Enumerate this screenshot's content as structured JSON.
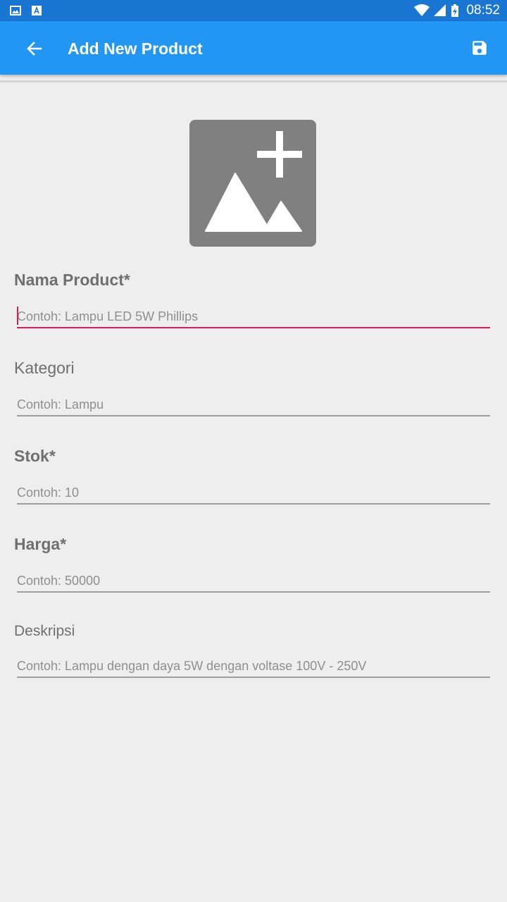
{
  "status_bar": {
    "time": "08:52"
  },
  "app_bar": {
    "title": "Add New Product"
  },
  "form": {
    "fields": [
      {
        "label": "Nama Product*",
        "placeholder": "Contoh: Lampu LED 5W Phillips",
        "value": ""
      },
      {
        "label": "Kategori",
        "placeholder": "Contoh: Lampu",
        "value": ""
      },
      {
        "label": "Stok*",
        "placeholder": "Contoh: 10",
        "value": ""
      },
      {
        "label": "Harga*",
        "placeholder": "Contoh: 50000",
        "value": ""
      },
      {
        "label": "Deskripsi",
        "placeholder": "Contoh: Lampu dengan daya 5W dengan voltase 100V - 250V",
        "value": ""
      }
    ]
  },
  "icons": {
    "back": "arrow-back-icon",
    "save": "floppy-disk-icon",
    "image_picker": "add-photo-icon"
  },
  "colors": {
    "status_bar": "#1976d2",
    "app_bar": "#2196f3",
    "accent": "#d81b60",
    "image_placeholder": "#808080"
  }
}
